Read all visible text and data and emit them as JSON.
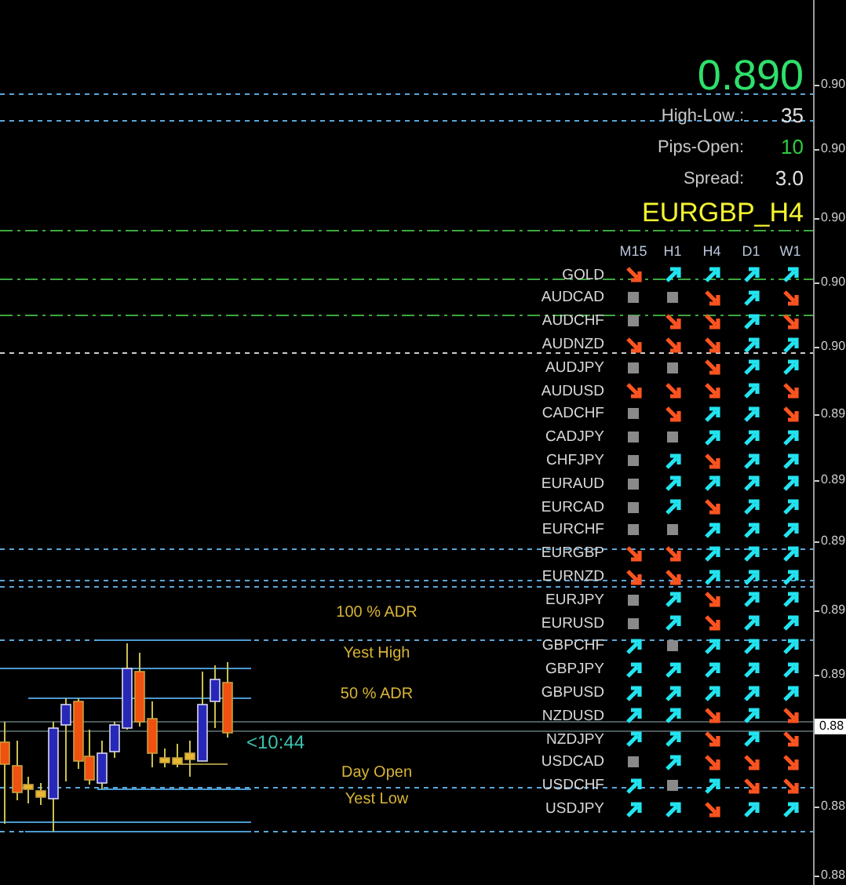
{
  "price": "0.890",
  "stats": [
    {
      "label": "High-Low :",
      "value": "35",
      "kind": "plain"
    },
    {
      "label": "Pips-Open:",
      "value": "10",
      "kind": "positive"
    },
    {
      "label": "Spread:",
      "value": "3.0",
      "kind": "plain"
    }
  ],
  "symbol_title": "EURGBP_H4",
  "trend_table": {
    "columns": [
      "M15",
      "H1",
      "H4",
      "D1",
      "W1"
    ],
    "rows": [
      {
        "symbol": "GOLD",
        "trends": [
          {
            "kind": "down"
          },
          {
            "kind": "up"
          },
          {
            "kind": "up"
          },
          {
            "kind": "up"
          },
          {
            "kind": "up"
          }
        ]
      },
      {
        "symbol": "AUDCAD",
        "trends": [
          {
            "kind": "flat"
          },
          {
            "kind": "flat"
          },
          {
            "kind": "down"
          },
          {
            "kind": "up"
          },
          {
            "kind": "down"
          }
        ]
      },
      {
        "symbol": "AUDCHF",
        "trends": [
          {
            "kind": "flat"
          },
          {
            "kind": "down"
          },
          {
            "kind": "down"
          },
          {
            "kind": "up"
          },
          {
            "kind": "down"
          }
        ]
      },
      {
        "symbol": "AUDNZD",
        "trends": [
          {
            "kind": "down"
          },
          {
            "kind": "down"
          },
          {
            "kind": "down"
          },
          {
            "kind": "up"
          },
          {
            "kind": "up"
          }
        ]
      },
      {
        "symbol": "AUDJPY",
        "trends": [
          {
            "kind": "flat"
          },
          {
            "kind": "flat"
          },
          {
            "kind": "down"
          },
          {
            "kind": "up"
          },
          {
            "kind": "up"
          }
        ]
      },
      {
        "symbol": "AUDUSD",
        "trends": [
          {
            "kind": "down"
          },
          {
            "kind": "down"
          },
          {
            "kind": "down"
          },
          {
            "kind": "up"
          },
          {
            "kind": "down"
          }
        ]
      },
      {
        "symbol": "CADCHF",
        "trends": [
          {
            "kind": "flat"
          },
          {
            "kind": "down"
          },
          {
            "kind": "up"
          },
          {
            "kind": "up"
          },
          {
            "kind": "down"
          }
        ]
      },
      {
        "symbol": "CADJPY",
        "trends": [
          {
            "kind": "flat"
          },
          {
            "kind": "flat"
          },
          {
            "kind": "up"
          },
          {
            "kind": "up"
          },
          {
            "kind": "up"
          }
        ]
      },
      {
        "symbol": "CHFJPY",
        "trends": [
          {
            "kind": "flat"
          },
          {
            "kind": "up"
          },
          {
            "kind": "down"
          },
          {
            "kind": "up"
          },
          {
            "kind": "up"
          }
        ]
      },
      {
        "symbol": "EURAUD",
        "trends": [
          {
            "kind": "flat"
          },
          {
            "kind": "up"
          },
          {
            "kind": "up"
          },
          {
            "kind": "up"
          },
          {
            "kind": "up"
          }
        ]
      },
      {
        "symbol": "EURCAD",
        "trends": [
          {
            "kind": "flat"
          },
          {
            "kind": "up"
          },
          {
            "kind": "down"
          },
          {
            "kind": "up"
          },
          {
            "kind": "up"
          }
        ]
      },
      {
        "symbol": "EURCHF",
        "trends": [
          {
            "kind": "flat"
          },
          {
            "kind": "flat"
          },
          {
            "kind": "up"
          },
          {
            "kind": "up"
          },
          {
            "kind": "up"
          }
        ]
      },
      {
        "symbol": "EURGBP",
        "trends": [
          {
            "kind": "down"
          },
          {
            "kind": "down"
          },
          {
            "kind": "up"
          },
          {
            "kind": "up"
          },
          {
            "kind": "up"
          }
        ]
      },
      {
        "symbol": "EURNZD",
        "trends": [
          {
            "kind": "down"
          },
          {
            "kind": "down"
          },
          {
            "kind": "up"
          },
          {
            "kind": "up"
          },
          {
            "kind": "up"
          }
        ]
      },
      {
        "symbol": "EURJPY",
        "trends": [
          {
            "kind": "flat"
          },
          {
            "kind": "up"
          },
          {
            "kind": "down"
          },
          {
            "kind": "up"
          },
          {
            "kind": "up"
          }
        ]
      },
      {
        "symbol": "EURUSD",
        "trends": [
          {
            "kind": "flat"
          },
          {
            "kind": "up"
          },
          {
            "kind": "down"
          },
          {
            "kind": "up"
          },
          {
            "kind": "up"
          }
        ]
      },
      {
        "symbol": "GBPCHF",
        "trends": [
          {
            "kind": "up"
          },
          {
            "kind": "flat"
          },
          {
            "kind": "up"
          },
          {
            "kind": "up"
          },
          {
            "kind": "up"
          }
        ]
      },
      {
        "symbol": "GBPJPY",
        "trends": [
          {
            "kind": "up"
          },
          {
            "kind": "up"
          },
          {
            "kind": "up"
          },
          {
            "kind": "up"
          },
          {
            "kind": "up"
          }
        ]
      },
      {
        "symbol": "GBPUSD",
        "trends": [
          {
            "kind": "up"
          },
          {
            "kind": "up"
          },
          {
            "kind": "up"
          },
          {
            "kind": "up"
          },
          {
            "kind": "up"
          }
        ]
      },
      {
        "symbol": "NZDUSD",
        "trends": [
          {
            "kind": "up"
          },
          {
            "kind": "up"
          },
          {
            "kind": "down"
          },
          {
            "kind": "up"
          },
          {
            "kind": "down"
          }
        ]
      },
      {
        "symbol": "NZDJPY",
        "trends": [
          {
            "kind": "up"
          },
          {
            "kind": "up"
          },
          {
            "kind": "down"
          },
          {
            "kind": "up"
          },
          {
            "kind": "down"
          }
        ]
      },
      {
        "symbol": "USDCAD",
        "trends": [
          {
            "kind": "flat"
          },
          {
            "kind": "up"
          },
          {
            "kind": "down"
          },
          {
            "kind": "down"
          },
          {
            "kind": "down"
          }
        ]
      },
      {
        "symbol": "USDCHF",
        "trends": [
          {
            "kind": "up"
          },
          {
            "kind": "flat"
          },
          {
            "kind": "up"
          },
          {
            "kind": "down"
          },
          {
            "kind": "down"
          }
        ]
      },
      {
        "symbol": "USDJPY",
        "trends": [
          {
            "kind": "up"
          },
          {
            "kind": "up"
          },
          {
            "kind": "down"
          },
          {
            "kind": "up"
          },
          {
            "kind": "up"
          }
        ]
      }
    ]
  },
  "level_labels": [
    "100 % ADR",
    "Yest High",
    "50 % ADR",
    "Day Open",
    "Yest Low"
  ],
  "time_label": "<10:44",
  "price_axis": {
    "labels": [
      "0.90",
      "0.90",
      "0.90",
      "0.90",
      "0.90",
      "0.89",
      "0.89",
      "0.89",
      "0.89",
      "0.89",
      "0.88",
      "0.88"
    ],
    "current_price": "0.88"
  }
}
